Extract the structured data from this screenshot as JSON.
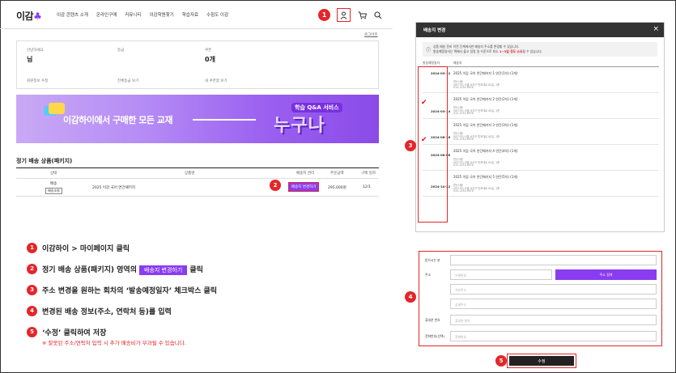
{
  "header": {
    "logo": "이감",
    "logo_mark": "♣",
    "nav": [
      "이감 콘텐츠 소개",
      "온라인구매",
      "커뮤니티",
      "이감학원찾기",
      "학습자료",
      "수험도 이감"
    ],
    "logout": "로그아웃"
  },
  "icons": {
    "user": "user-icon",
    "cart": "cart-icon",
    "search": "search-icon"
  },
  "info": {
    "c1": {
      "label": "안녕하세요",
      "value": "님",
      "link": "회원정보 수정"
    },
    "c2": {
      "label": "등급",
      "value": "",
      "link": "전체등급 보기"
    },
    "c3": {
      "label": "쿠폰",
      "value": "0개",
      "link": "내 쿠폰함 보기"
    }
  },
  "banner": {
    "text": "이감하이에서 구매한 모든 교재",
    "qa": "학습 Q&A 서비스",
    "big": "누구나"
  },
  "subscription": {
    "title": "정기 배송 상품(패키지)",
    "headers": [
      "상태",
      "상품명",
      "배송지 관리",
      "주문금액",
      "구매 일자"
    ],
    "row": {
      "status": "배송",
      "status_tag": "배송조회",
      "product": "2025 이감 국어 연간패키지",
      "change_button": "배송지 변경하기",
      "price": "295,000원",
      "date": "12/1"
    }
  },
  "steps": {
    "s1": {
      "num": "1",
      "text": "이감하이 > 마이페이지 클릭"
    },
    "s2": {
      "num": "2",
      "pre": "정기 배송 상품(패키지) 영역의",
      "pill": "배송지 변경하기",
      "post": "클릭"
    },
    "s3": {
      "num": "3",
      "text": "주소 변경을 원하는 회차의 ‘발송예정일자’ 체크박스 클릭"
    },
    "s4": {
      "num": "4",
      "text": "변경된 배송 정보(주소, 연락처 등)를 입력"
    },
    "s5": {
      "num": "5",
      "text": "‘수정’ 클릭하여 저장"
    },
    "warning": "※ 잘못된 주소/연락처 입력 시 추가 배송비가 부과될 수 있습니다."
  },
  "modal": {
    "title": "배송지 변경",
    "close": "×",
    "notice1": "상품 배송 준비 이전 단계에서만 배송지 주소를 변경할 수 있습니다.",
    "notice2_pre": "발송예정일자는 택배사 물고 일정 일 수준으로 최소",
    "notice2_bold": "1~3일 정도 소요",
    "notice2_post": "될 수 있습니다.",
    "col1": "발송예정일자",
    "col2": "배송지",
    "rows": [
      {
        "date": "2024-03-12",
        "name": "2025 이감 국어 연간패키지 1 연간(1차) (1개)",
        "a": "받는사람",
        "b": "(00779) 서울 서초구 반포대로 00길, 1층",
        "c": "010-1234-5678"
      },
      {
        "date": "2024-03-14",
        "name": "2025 이감 국어 연간패키지 2 연간(2차) (1개)",
        "a": "받는사람",
        "b": "(00779) 서울 서초구 반포대로 00길, 1층",
        "c": "010-1234-5678"
      },
      {
        "date": "2024-06-18",
        "name": "2025 이감 국어 연간패키지 3 연간(3차) (1개)",
        "a": "받는사람",
        "b": "(00779) 서울 서초구 반포대로 00길, 1층",
        "c": "010-1234-5678"
      },
      {
        "date": "2024-08-06",
        "name": "2025 이감 국어 연간패키지 4 연간(4차) (1개)",
        "a": "받는사람",
        "b": "(00779) 서울 서초구 반포대로 00길, 1층",
        "c": "010-1234-5678"
      },
      {
        "date": "2024-10-22",
        "name": "2025 이감 국어 연간패키지 5 연간(5차) (1개)",
        "a": "받는사람",
        "b": "(00779) 서울 서초구 반포대로 00길, 1층",
        "c": "010-1234-5678"
      }
    ]
  },
  "form": {
    "receiver": "받으시는 분",
    "address": "주소",
    "zip_ph": "우편번호",
    "search_btn": "주소 검색",
    "addr1_ph": "기본주소",
    "addr2_ph": "상세주소",
    "mobile": "휴대폰 번호",
    "mobile_ph": "휴대폰 번호",
    "phone": "전화번호(선택)",
    "phone_ph": "전화번호"
  },
  "submit": "수정",
  "badges": {
    "b1": "1",
    "b2": "2",
    "b3": "3",
    "b4": "4",
    "b5": "5"
  },
  "colors": {
    "accent": "#8a3cf0",
    "callout": "#e3262a"
  }
}
